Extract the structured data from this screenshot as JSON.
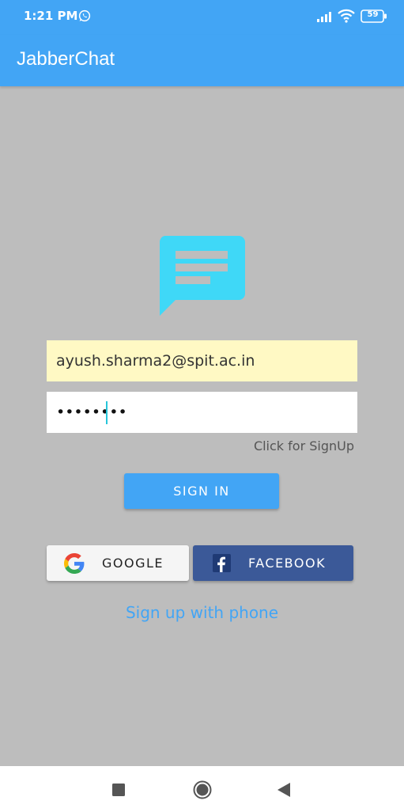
{
  "status_bar": {
    "time": "1:21 PM",
    "battery": "59"
  },
  "app_bar": {
    "title": "JabberChat"
  },
  "login": {
    "email_value": "ayush.sharma2@spit.ac.in",
    "email_placeholder": "",
    "password_value": "••••••••",
    "signup_link": "Click for SignUp",
    "signin_label": "SIGN IN",
    "google_label": "GOOGLE",
    "facebook_label": "FACEBOOK",
    "phone_signup_label": "Sign up with phone"
  },
  "colors": {
    "primary": "#42a5f5",
    "background": "#bdbdbd",
    "logo": "#3fd8f7",
    "email_fill": "#fff9c4",
    "facebook": "#3b5998",
    "cursor": "#26c6da"
  },
  "icons": {
    "whatsapp": "whatsapp-icon",
    "signal": "signal-icon",
    "wifi": "wifi-icon",
    "battery": "battery-icon",
    "logo": "chat-bubble-icon",
    "google": "google-icon",
    "facebook": "facebook-icon",
    "recents": "recents-icon",
    "home": "home-icon",
    "back": "back-icon"
  }
}
